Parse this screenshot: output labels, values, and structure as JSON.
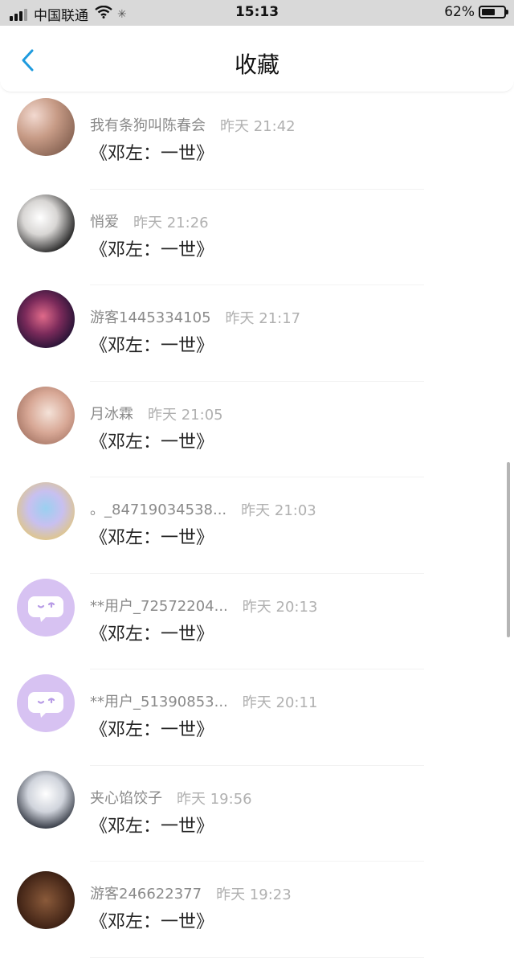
{
  "status_bar": {
    "carrier": "中国联通",
    "time": "15:13",
    "battery": "62%",
    "battery_level": 0.62
  },
  "header": {
    "title": "收藏",
    "back_icon": "chevron-left-icon"
  },
  "colors": {
    "accent": "#1f9bde",
    "name_text": "#8a8a8a",
    "time_text": "#b0b0b0",
    "content_text": "#222222",
    "default_avatar_bg": "#d7c2f2"
  },
  "favorites": [
    {
      "name": "我有条狗叫陈春会",
      "time": "昨天 21:42",
      "content": "《邓左：一世》",
      "avatar": "photo-avatar"
    },
    {
      "name": "悄爱",
      "time": "昨天 21:26",
      "content": "《邓左：一世》",
      "avatar": "photo-avatar"
    },
    {
      "name": "游客1445334105",
      "time": "昨天 21:17",
      "content": "《邓左：一世》",
      "avatar": "photo-avatar"
    },
    {
      "name": "月冰霖",
      "time": "昨天 21:05",
      "content": "《邓左：一世》",
      "avatar": "photo-avatar"
    },
    {
      "name": "。_84719034538...",
      "time": "昨天 21:03",
      "content": "《邓左：一世》",
      "avatar": "photo-avatar"
    },
    {
      "name": "**用户_72572204...",
      "time": "昨天 20:13",
      "content": "《邓左：一世》",
      "avatar": "default-chat-avatar"
    },
    {
      "name": "**用户_51390853...",
      "time": "昨天 20:11",
      "content": "《邓左：一世》",
      "avatar": "default-chat-avatar"
    },
    {
      "name": "夹心馅饺子",
      "time": "昨天 19:56",
      "content": "《邓左：一世》",
      "avatar": "photo-avatar"
    },
    {
      "name": "游客246622377",
      "time": "昨天 19:23",
      "content": "《邓左：一世》",
      "avatar": "photo-avatar"
    }
  ]
}
